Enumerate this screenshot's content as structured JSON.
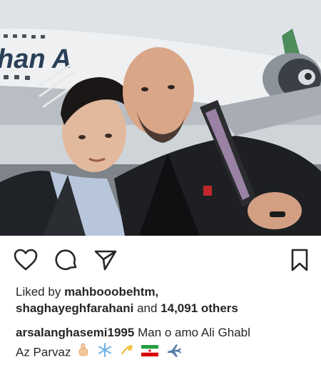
{
  "post": {
    "photo_description_icon": "selfie-photo",
    "likes": {
      "prefix": "Liked by",
      "first_user": "mahbooobehtm,",
      "second_user": "shaghayeghfarahani",
      "connector": "and",
      "count_text": "14,091 others"
    },
    "caption": {
      "username": "arsalanghasemi1995",
      "text_line1": "Man o amo Ali Ghabl",
      "text_line2": "Az Parvaz"
    },
    "emojis": [
      "point-up-emoji",
      "snowflake-emoji",
      "dizzy-emoji",
      "iran-flag-emoji",
      "airplane-emoji"
    ],
    "plane_text": "han A"
  },
  "actions": {
    "like_icon": "heart-icon",
    "comment_icon": "comment-icon",
    "share_icon": "paper-plane-icon",
    "save_icon": "bookmark-icon"
  }
}
